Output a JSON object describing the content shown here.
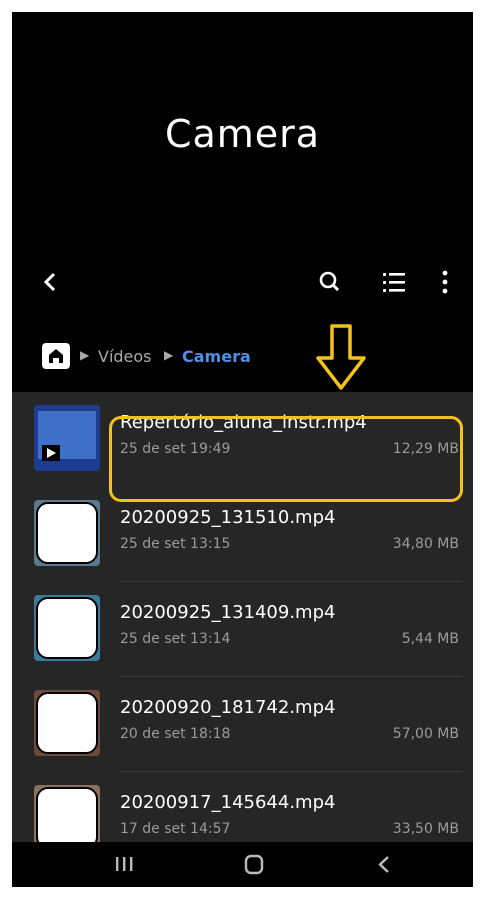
{
  "header": {
    "title": "Camera"
  },
  "breadcrumb": {
    "items": [
      "Vídeos",
      "Camera"
    ]
  },
  "files": [
    {
      "name": "Repertório_aluna_instr.mp4",
      "date": "25 de set 19:49",
      "size": "12,29 MB",
      "highlighted": true
    },
    {
      "name": "20200925_131510.mp4",
      "date": "25 de set 13:15",
      "size": "34,80 MB"
    },
    {
      "name": "20200925_131409.mp4",
      "date": "25 de set 13:14",
      "size": "5,44 MB"
    },
    {
      "name": "20200920_181742.mp4",
      "date": "20 de set 18:18",
      "size": "57,00 MB"
    },
    {
      "name": "20200917_145644.mp4",
      "date": "17 de set 14:57",
      "size": "33,50 MB"
    }
  ],
  "icons": {
    "back": "back-arrow-icon",
    "search": "search-icon",
    "view": "list-view-icon",
    "more": "more-options-icon",
    "home": "home-icon",
    "annotation": "down-arrow-icon"
  },
  "colors": {
    "accent": "#4e8fe8",
    "highlight": "#f5c21b",
    "list_bg": "#262626"
  }
}
